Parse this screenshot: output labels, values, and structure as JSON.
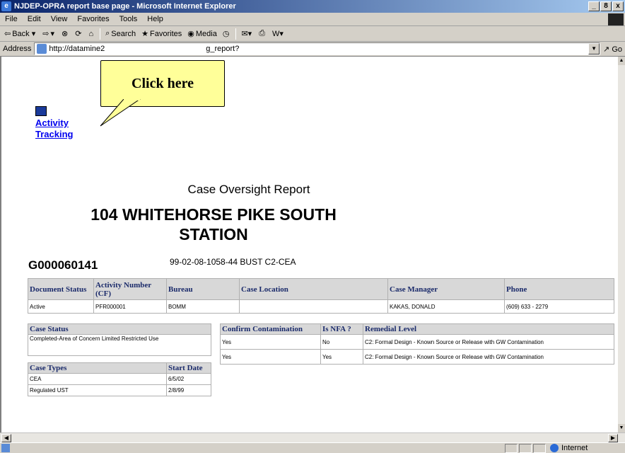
{
  "window": {
    "title": "NJDEP-OPRA report base page - Microsoft Internet Explorer",
    "min": "_",
    "max": "8",
    "close": "x"
  },
  "menu": [
    "File",
    "Edit",
    "View",
    "Favorites",
    "Tools",
    "Help"
  ],
  "toolbar": {
    "back": "Back",
    "search": "Search",
    "favorites": "Favorites",
    "media": "Media"
  },
  "address": {
    "label": "Address",
    "url_start": "http://datamine2",
    "url_end": "g_report?",
    "go": "Go"
  },
  "callout": "Click here",
  "activity_link": {
    "line1": "Activity",
    "line2": "Tracking"
  },
  "report": {
    "title": "Case Oversight Report",
    "site_line1": "104 WHITEHORSE PIKE SOUTH",
    "site_line2": "STATION",
    "case_id": "G000060141",
    "case_ref": "99-02-08-1058-44 BUST  C2-CEA"
  },
  "main_table": {
    "headers": [
      "Document Status",
      "Activity Number (CF)",
      "Bureau",
      "Case Location",
      "Case Manager",
      "Phone"
    ],
    "row": [
      "Active",
      "PFR000001",
      "BOMM",
      "",
      "KAKAS, DONALD",
      "(609) 633 - 2279"
    ]
  },
  "case_status": {
    "header": "Case Status",
    "value": "Completed-Area of Concern Limited Restricted Use"
  },
  "confirm_table": {
    "headers": [
      "Confirm Contamination",
      "Is NFA ?",
      "Remedial Level"
    ],
    "rows": [
      [
        "Yes",
        "No",
        "C2: Formal Design - Known Source or Release with GW Contamination"
      ],
      [
        "Yes",
        "Yes",
        "C2: Formal Design - Known Source or Release with GW Contamination"
      ]
    ]
  },
  "case_types": {
    "headers": [
      "Case Types",
      "Start Date"
    ],
    "rows": [
      [
        "CEA",
        "6/5/02"
      ],
      [
        "Regulated UST",
        "2/8/99"
      ]
    ]
  },
  "status": {
    "zone": "Internet"
  }
}
